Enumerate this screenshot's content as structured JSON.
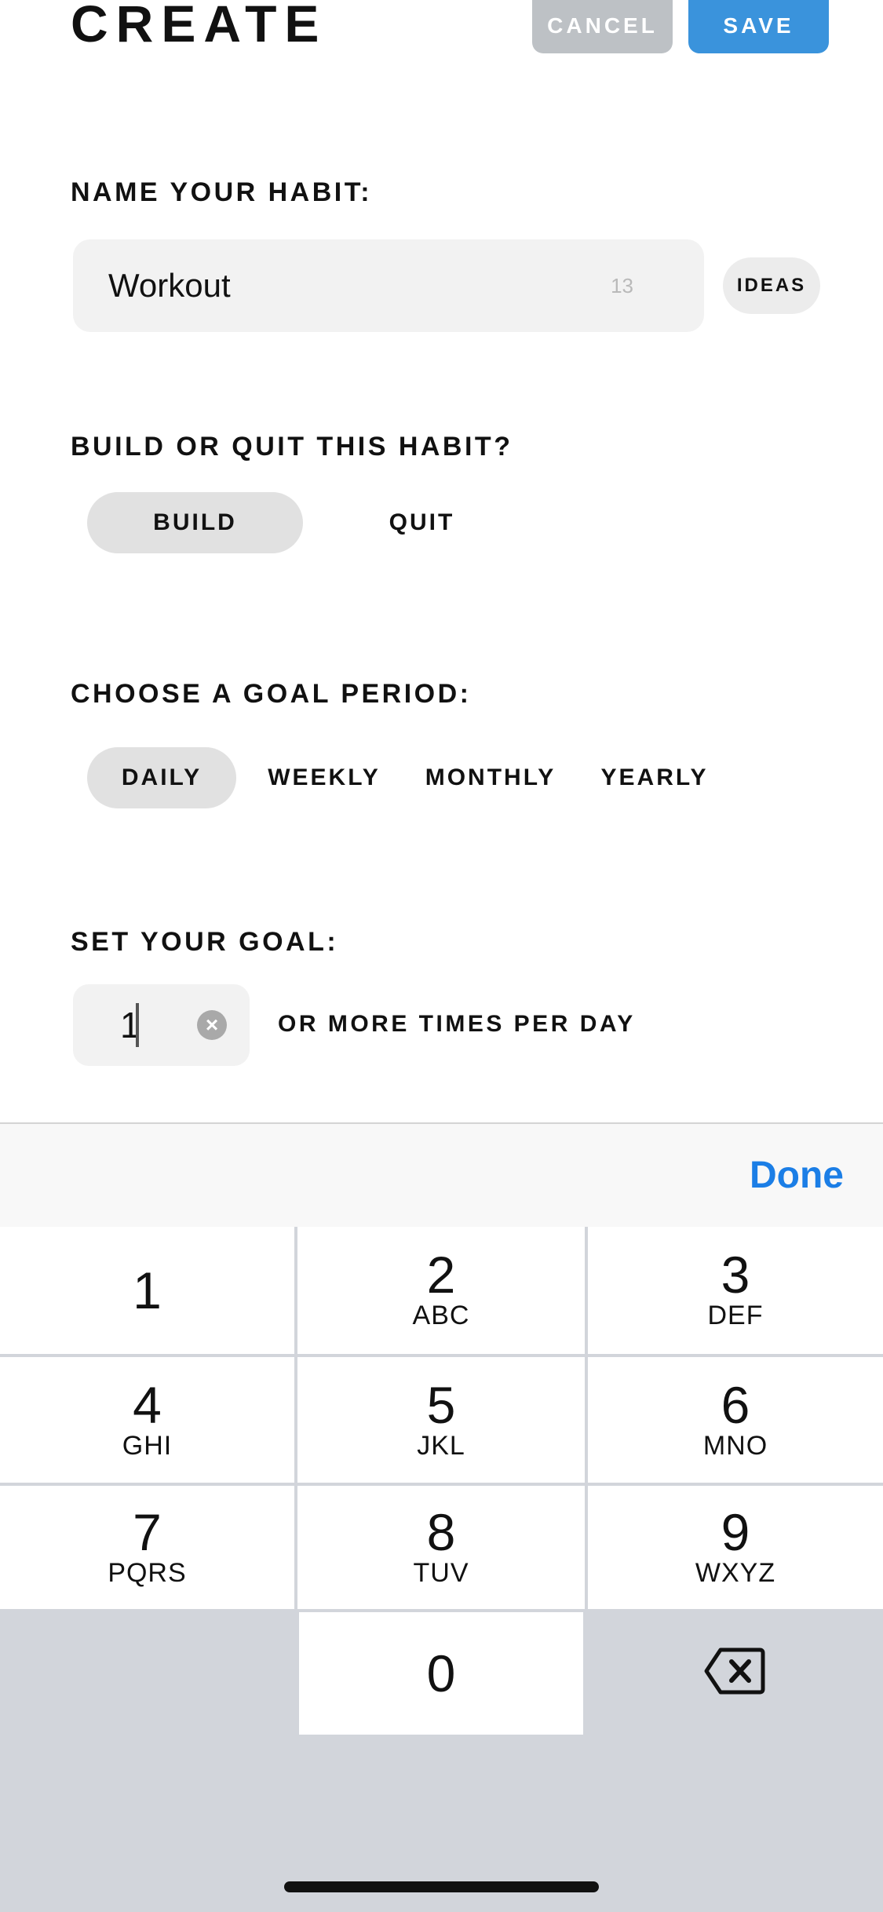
{
  "header": {
    "title": "CREATE",
    "cancel_label": "CANCEL",
    "save_label": "SAVE"
  },
  "name_section": {
    "label": "NAME YOUR HABIT:",
    "value": "Workout",
    "char_count": "13",
    "ideas_label": "IDEAS"
  },
  "habit_type": {
    "label": "BUILD OR QUIT THIS HABIT?",
    "options": [
      "BUILD",
      "QUIT"
    ],
    "selected": "BUILD"
  },
  "goal_period": {
    "label": "CHOOSE A GOAL PERIOD:",
    "options": [
      "DAILY",
      "WEEKLY",
      "MONTHLY",
      "YEARLY"
    ],
    "selected": "DAILY"
  },
  "goal": {
    "label": "SET YOUR GOAL:",
    "value": "1",
    "suffix": "OR MORE TIMES PER DAY"
  },
  "keyboard": {
    "done_label": "Done",
    "keys": [
      {
        "num": "1",
        "letters": ""
      },
      {
        "num": "2",
        "letters": "ABC"
      },
      {
        "num": "3",
        "letters": "DEF"
      },
      {
        "num": "4",
        "letters": "GHI"
      },
      {
        "num": "5",
        "letters": "JKL"
      },
      {
        "num": "6",
        "letters": "MNO"
      },
      {
        "num": "7",
        "letters": "PQRS"
      },
      {
        "num": "8",
        "letters": "TUV"
      },
      {
        "num": "9",
        "letters": "WXYZ"
      },
      {
        "num": "0",
        "letters": ""
      }
    ]
  },
  "colors": {
    "accent_blue": "#3a93dc",
    "done_blue": "#1b7ee6",
    "cancel_gray": "#bdc1c5",
    "selected_pill": "#e1e1e1",
    "keyboard_bg": "#d2d5db"
  }
}
